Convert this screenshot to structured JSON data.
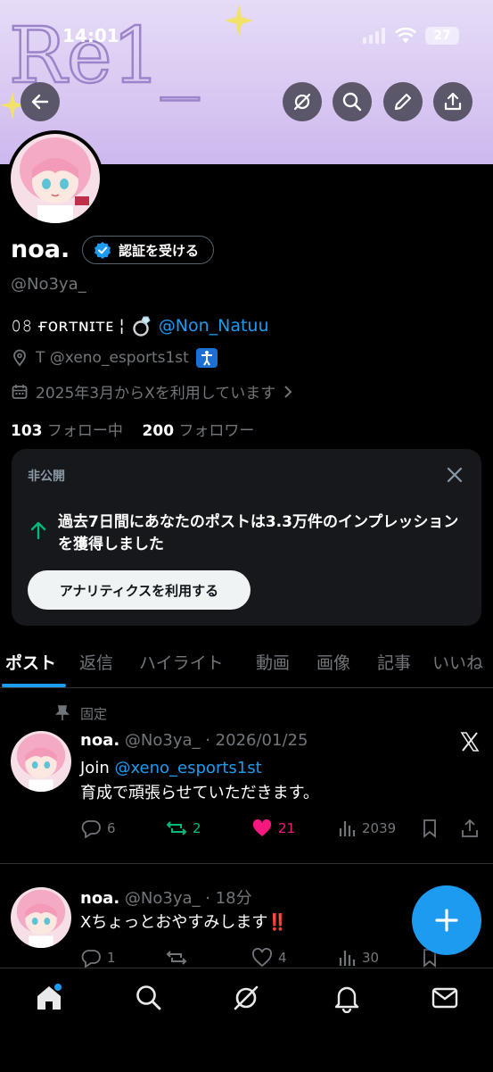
{
  "status_bar": {
    "time": "14:01",
    "battery": "27"
  },
  "banner": {
    "scribble": "Re1_"
  },
  "profile": {
    "name": "noa.",
    "verify_label": "認証を受ける",
    "handle": "@No3ya_",
    "bio_prefix": "𝟶𝟾 ғᴏʀᴛɴɪᴛᴇ ¦",
    "bio_link": "@Non_Natuu",
    "location": "T @xeno_esports1st",
    "joined": "2025年3月からXを利用しています",
    "following_count": "103",
    "following_label": "フォロー中",
    "followers_count": "200",
    "followers_label": "フォロワー"
  },
  "analytics_card": {
    "label": "非公開",
    "message": "過去7日間にあなたのポストは3.3万件のインプレッションを獲得しました",
    "button": "アナリティクスを利用する"
  },
  "tabs": [
    "ポスト",
    "返信",
    "ハイライト",
    "動画",
    "画像",
    "記事",
    "いいね"
  ],
  "posts": [
    {
      "pinned_label": "固定",
      "name": "noa.",
      "handle_time": "@No3ya_ · 2026/01/25",
      "text_prefix": "Join ",
      "text_link": "@xeno_esports1st",
      "text_line2": "育成で頑張らせていただきます。",
      "replies": "6",
      "reposts": "2",
      "likes": "21",
      "views": "2039"
    },
    {
      "name": "noa.",
      "handle_time": "@No3ya_ · 18分",
      "text": "Xちょっとおやすみします‼️",
      "replies": "1",
      "reposts": "",
      "likes": "4",
      "views": "30"
    }
  ],
  "colors": {
    "accent": "#1d9bf0",
    "like": "#f91880",
    "repost": "#00ba7c"
  },
  "icons": [
    "back-icon",
    "grok-icon",
    "search-icon",
    "edit-icon",
    "share-icon",
    "verified-icon",
    "ring-icon",
    "location-icon",
    "calendar-icon",
    "chevron-right-icon",
    "close-icon",
    "up-arrow-icon",
    "pin-icon",
    "x-logo-icon",
    "reply-icon",
    "repost-icon",
    "like-icon",
    "views-icon",
    "bookmark-icon",
    "home-icon",
    "notifications-icon",
    "messages-icon",
    "compose-icon"
  ]
}
